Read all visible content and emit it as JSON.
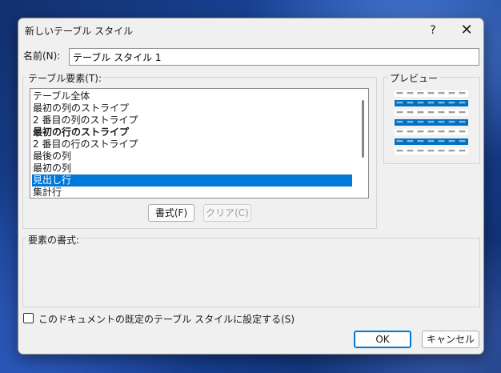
{
  "dialog": {
    "title": "新しいテーブル スタイル",
    "help_label": "?",
    "close_label": "✕"
  },
  "name": {
    "label": "名前(N):",
    "value": "テーブル スタイル 1"
  },
  "elements": {
    "label": "テーブル要素(T):",
    "items": [
      {
        "label": "テーブル全体",
        "bold": false,
        "selected": false
      },
      {
        "label": "最初の列のストライプ",
        "bold": false,
        "selected": false
      },
      {
        "label": "2 番目の列のストライプ",
        "bold": false,
        "selected": false
      },
      {
        "label": "最初の行のストライプ",
        "bold": true,
        "selected": false
      },
      {
        "label": "2 番目の行のストライプ",
        "bold": false,
        "selected": false
      },
      {
        "label": "最後の列",
        "bold": false,
        "selected": false
      },
      {
        "label": "最初の列",
        "bold": false,
        "selected": false
      },
      {
        "label": "見出し行",
        "bold": false,
        "selected": true
      },
      {
        "label": "集計行",
        "bold": false,
        "selected": false
      }
    ],
    "format_button": "書式(F)",
    "clear_button": "クリア(C)"
  },
  "preview": {
    "label": "プレビュー",
    "cell_glyph": "»»»",
    "stripe_color": "#0070c0",
    "plain_color": "#ffffff",
    "rows": [
      "plain",
      "stripe",
      "plain",
      "stripe",
      "plain",
      "stripe",
      "plain"
    ]
  },
  "element_format": {
    "label": "要素の書式:"
  },
  "default_checkbox": {
    "label": "このドキュメントの既定のテーブル スタイルに設定する(S)",
    "checked": false
  },
  "buttons": {
    "ok": "OK",
    "cancel": "キャンセル"
  }
}
